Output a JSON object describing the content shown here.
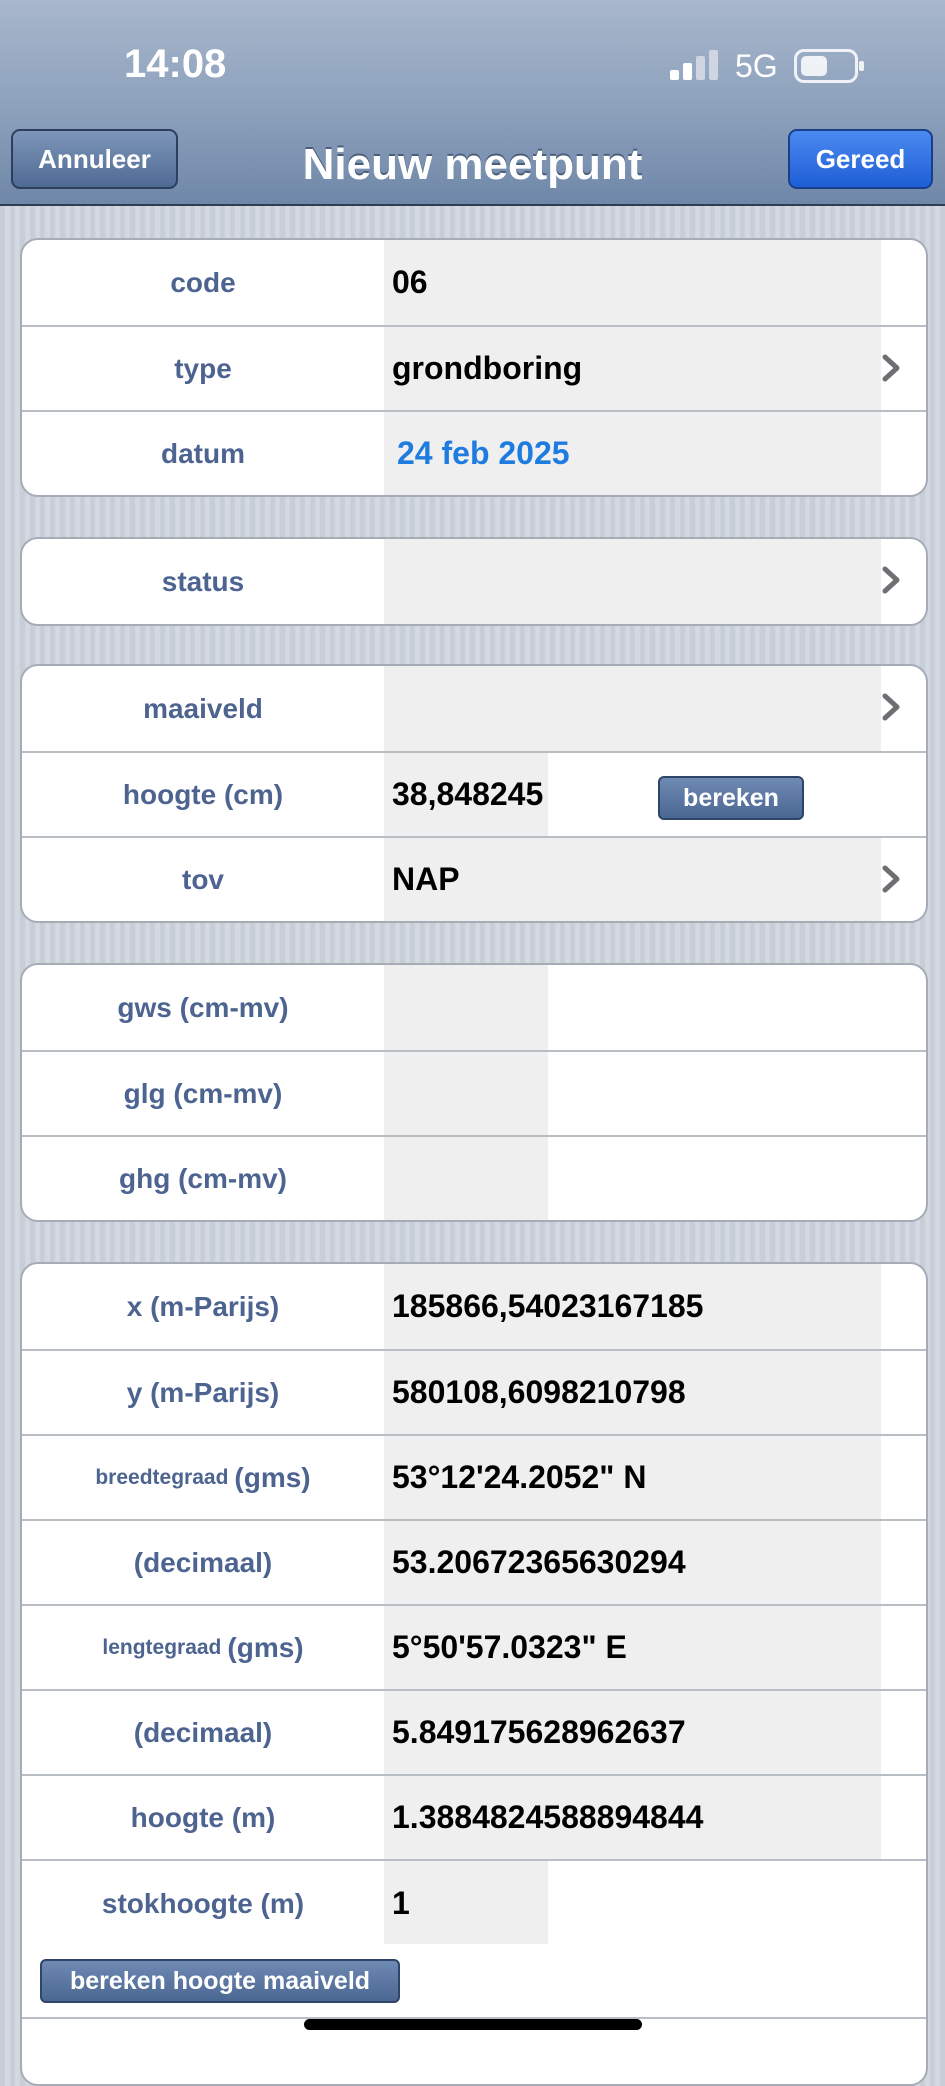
{
  "status_bar": {
    "time": "14:08",
    "network": "5G"
  },
  "nav": {
    "title": "Nieuw meetpunt",
    "cancel_label": "Annuleer",
    "done_label": "Gereed"
  },
  "group1": {
    "code": {
      "label": "code",
      "value": "06"
    },
    "type": {
      "label": "type",
      "value": "grondboring"
    },
    "datum": {
      "label": "datum",
      "value": "24 feb 2025"
    }
  },
  "group2": {
    "status": {
      "label": "status",
      "value": ""
    }
  },
  "group3": {
    "maaiveld": {
      "label": "maaiveld",
      "value": ""
    },
    "hoogte": {
      "label": "hoogte (cm)",
      "value": "38,848245",
      "button": "bereken"
    },
    "tov": {
      "label": "tov",
      "value": "NAP"
    }
  },
  "group4": {
    "gws": {
      "label": "gws (cm-mv)",
      "value": ""
    },
    "glg": {
      "label": "glg (cm-mv)",
      "value": ""
    },
    "ghg": {
      "label": "ghg (cm-mv)",
      "value": ""
    }
  },
  "group5": {
    "x": {
      "label": "x (m-Parijs)",
      "value": "185866,54023167185"
    },
    "y": {
      "label": "y (m-Parijs)",
      "value": "580108,6098210798"
    },
    "breedte_gms": {
      "label_small": "breedtegraad",
      "label": "(gms)",
      "value": "53°12'24.2052\" N"
    },
    "breedte_dec": {
      "label": "(decimaal)",
      "value": "53.20672365630294"
    },
    "lengte_gms": {
      "label_small": "lengtegraad",
      "label": "(gms)",
      "value": "5°50'57.0323\" E"
    },
    "lengte_dec": {
      "label": "(decimaal)",
      "value": "5.849175628962637"
    },
    "hoogte_m": {
      "label": "hoogte (m)",
      "value": "1.3884824588894844"
    },
    "stokhoogte": {
      "label": "stokhoogte (m)",
      "value": "1"
    },
    "bereken_button": "bereken hoogte maaiveld"
  },
  "colors": {
    "label": "#4d6491",
    "date": "#1e7be0",
    "done_button": "#1e5ed6"
  },
  "icons": [
    "signal-icon",
    "battery-icon",
    "chevron-right-icon"
  ]
}
